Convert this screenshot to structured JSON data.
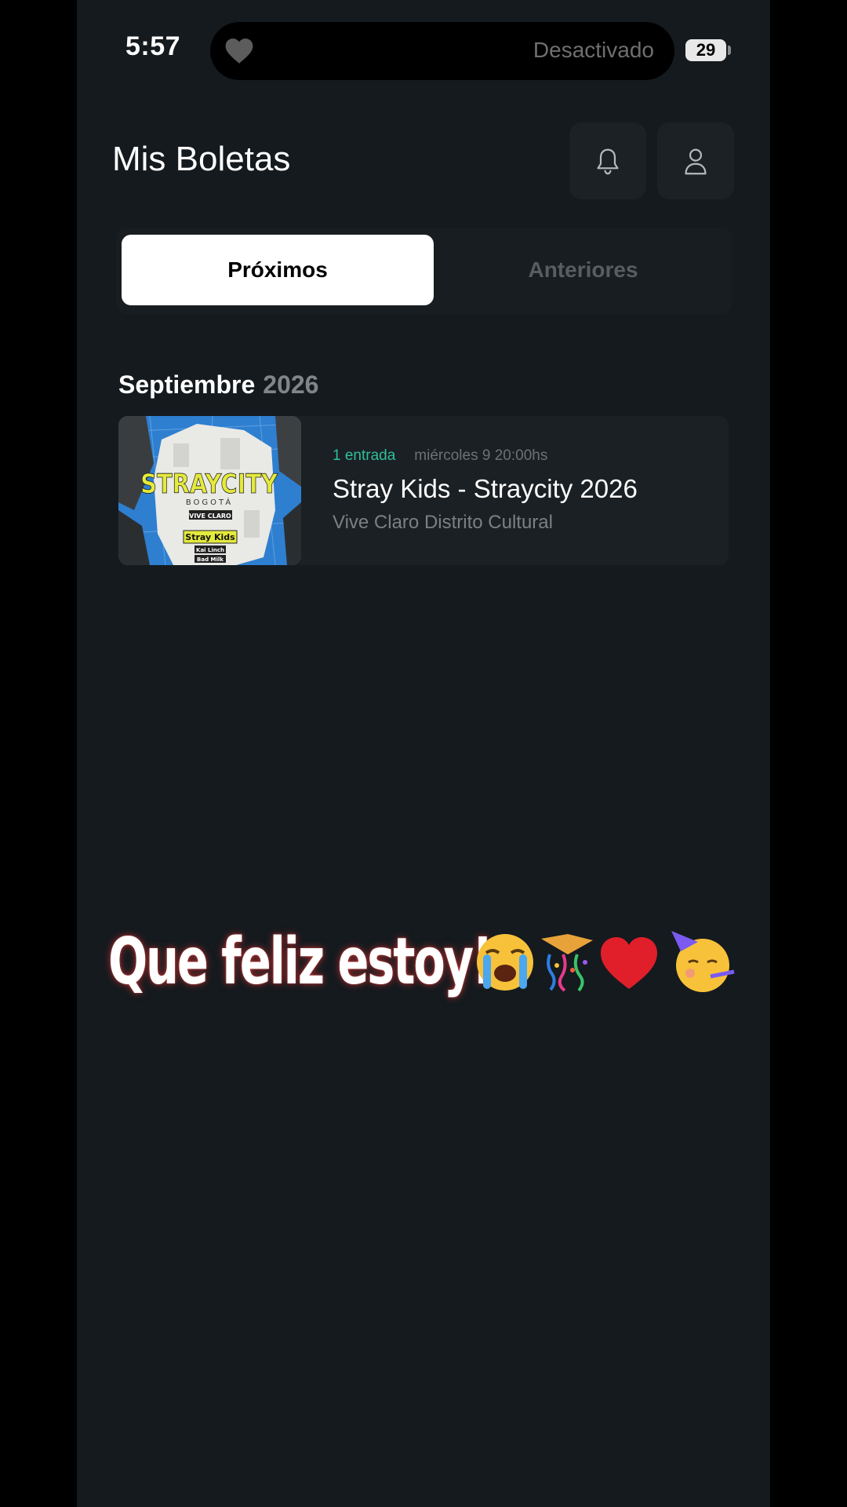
{
  "status_bar": {
    "time": "5:57",
    "island_text": "Desactivado",
    "battery": "29"
  },
  "header": {
    "title": "Mis Boletas",
    "icons": [
      "bell-icon",
      "user-icon"
    ]
  },
  "tabs": [
    {
      "label": "Próximos",
      "active": true
    },
    {
      "label": "Anteriores",
      "active": false
    }
  ],
  "section": {
    "month": "Septiembre",
    "year": "2026"
  },
  "events": [
    {
      "tickets": "1 entrada",
      "date": "miércoles 9 20:00hs",
      "title": "Stray Kids - Straycity 2026",
      "venue": "Vive Claro Distrito Cultural",
      "poster": {
        "headline": "STRAYCITY",
        "city": "BOGOTÁ",
        "venue_tag": "VIVE CLARO",
        "band": "Stray Kids",
        "support_1": "Kai Linch",
        "support_2": "Bad Milk"
      }
    }
  ],
  "caption": {
    "text": "Que feliz estoy!",
    "emojis": [
      "loudly-crying-face",
      "party-popper",
      "red-heart",
      "partying-face"
    ]
  },
  "colors": {
    "background": "#141a1e",
    "accent": "#2fbf9a",
    "poster_yellow": "#e4ea3c",
    "poster_blue": "#2e7fd0"
  }
}
